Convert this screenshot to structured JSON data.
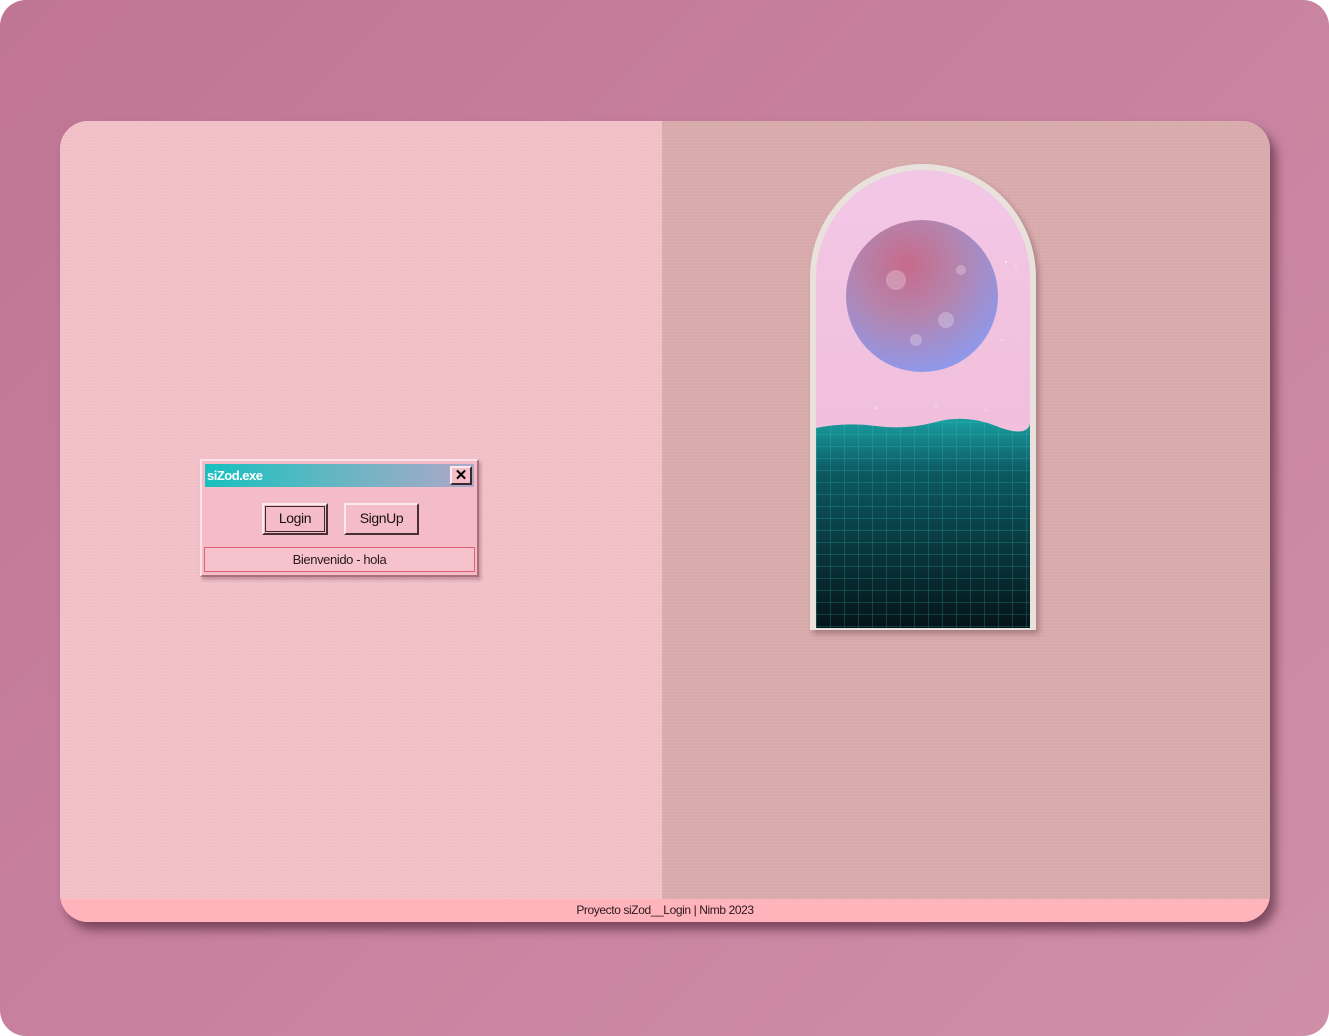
{
  "dialog": {
    "title": "siZod.exe",
    "close_symbol": "✕",
    "login_label": "Login",
    "signup_label": "SignUp",
    "status_text": "Bienvenido - hola"
  },
  "scene": {
    "icon": "vaporwave-moon-ocean-arch-image"
  },
  "footer": {
    "text": "Proyecto siZod__Login | Nimb 2023"
  },
  "colors": {
    "background": "#c47d9a",
    "left_pane": "#f1bec6",
    "right_pane": "#d7a9aa",
    "footer": "#ffb3bb",
    "titlebar_start": "#16c0bf",
    "titlebar_end": "#b0a7c9"
  }
}
